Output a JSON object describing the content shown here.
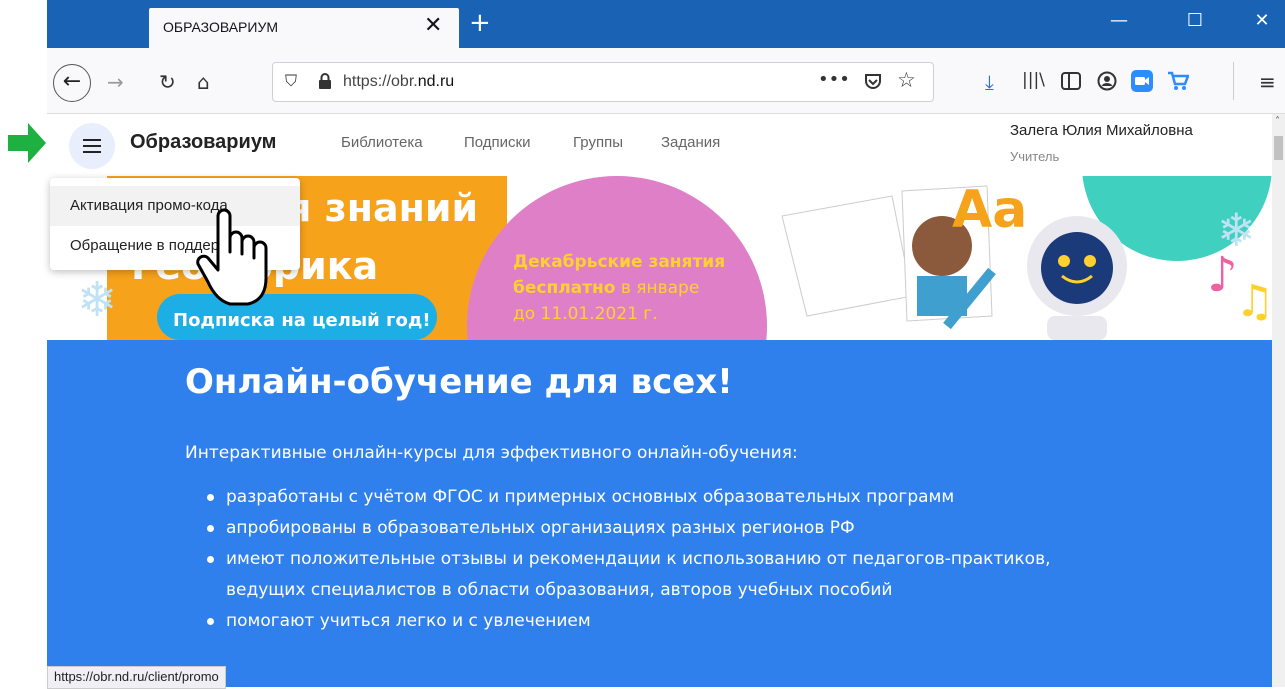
{
  "browser": {
    "tab_title": "ОБРАЗОВАРИУМ",
    "tab_close": "✕",
    "new_tab": "+",
    "url_prefix": "https://obr.",
    "url_domain": "nd.ru",
    "status_url": "https://obr.nd.ru/client/promo",
    "window_minimize": "—",
    "window_maximize": "☐",
    "window_close": "✕"
  },
  "site": {
    "brand": "Образовариум",
    "nav": [
      "Библиотека",
      "Подписки",
      "Группы",
      "Задания"
    ],
    "user_name": "Залега Юлия Михайловна",
    "user_role": "Учитель"
  },
  "dropdown": {
    "items": [
      "Активация промо-кода",
      "Обращение в поддержку"
    ]
  },
  "banner": {
    "line1": "я знаний",
    "line2": "Гео   орика",
    "subscription": "Подписка на целый год!",
    "promo_line1": "Декабрьские занятия",
    "promo_bold": "бесплатно",
    "promo_line2": "в январе",
    "promo_line3": "до 11.01.2021 г.",
    "letters": "Aa"
  },
  "hero": {
    "title": "Онлайн-обучение для всех!",
    "subtitle": "Интерактивные онлайн-курсы для эффективного онлайн-обучения:",
    "bullets": [
      "разработаны с учётом ФГОС и примерных основных образовательных программ",
      "апробированы в образовательных организациях разных регионов РФ",
      "имеют положительные отзывы и рекомендации к использованию от педагогов-практиков, ведущих специалистов в области образования, авторов учебных пособий",
      "помогают учиться легко и с увлечением"
    ]
  },
  "colors": {
    "titlebar": "#1a62b4",
    "hero": "#2f80ed",
    "accent_arrow": "#1db141",
    "banner_orange": "#f7a21b",
    "banner_pink": "#de7fc8"
  }
}
